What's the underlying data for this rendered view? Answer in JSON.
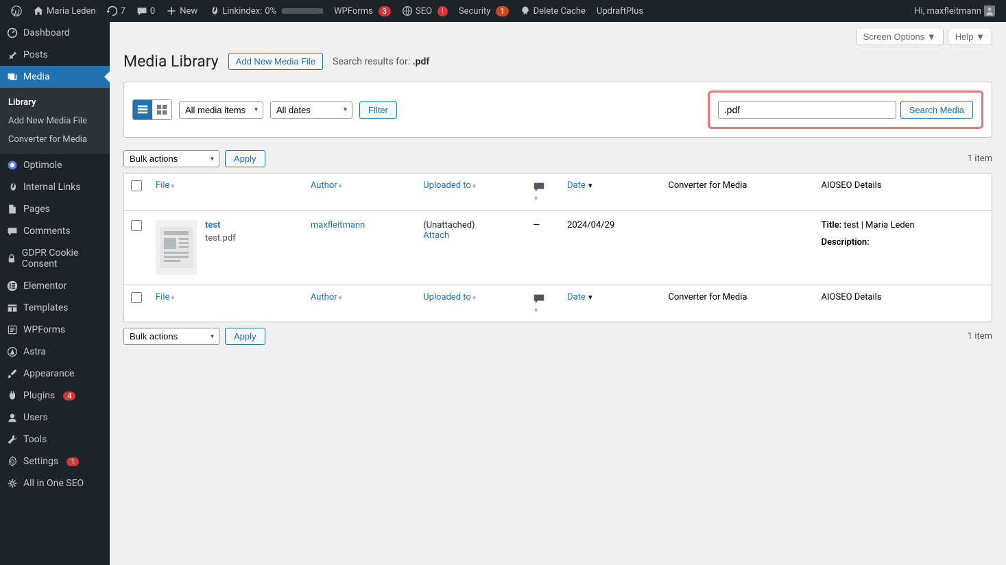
{
  "adminbar": {
    "site_name": "Maria Leden",
    "updates": "7",
    "comments": "0",
    "new_label": "New",
    "linkindex_label": "Linkindex:",
    "linkindex_pct": "0%",
    "wpforms_label": "WPForms",
    "wpforms_count": "3",
    "seo_label": "SEO",
    "seo_badge": "!",
    "security_label": "Security",
    "security_count": "1",
    "delete_cache": "Delete Cache",
    "updraft": "UpdraftPlus",
    "greeting": "Hi, maxfleitmann"
  },
  "screen": {
    "options": "Screen Options",
    "help": "Help"
  },
  "sidebar": {
    "dashboard": "Dashboard",
    "posts": "Posts",
    "media": "Media",
    "library": "Library",
    "add_new": "Add New Media File",
    "converter": "Converter for Media",
    "optimole": "Optimole",
    "internal_links": "Internal Links",
    "pages": "Pages",
    "comments": "Comments",
    "gdpr": "GDPR Cookie Consent",
    "elementor": "Elementor",
    "templates": "Templates",
    "wpforms": "WPForms",
    "astra": "Astra",
    "appearance": "Appearance",
    "plugins": "Plugins",
    "plugins_count": "4",
    "users": "Users",
    "tools": "Tools",
    "settings": "Settings",
    "settings_count": "1",
    "aioseo": "All in One SEO"
  },
  "page": {
    "title": "Media Library",
    "add_new": "Add New Media File",
    "search_results_label": "Search results for:",
    "search_term": ".pdf"
  },
  "filters": {
    "all_media": "All media items",
    "all_dates": "All dates",
    "filter_btn": "Filter",
    "search_value": ".pdf",
    "search_btn": "Search Media"
  },
  "bulk": {
    "actions": "Bulk actions",
    "apply": "Apply",
    "count": "1 item"
  },
  "columns": {
    "file": "File",
    "author": "Author",
    "uploaded_to": "Uploaded to",
    "date": "Date",
    "converter": "Converter for Media",
    "aioseo": "AIOSEO Details"
  },
  "row": {
    "title": "test",
    "filename": "test.pdf",
    "author": "maxfleitmann",
    "unattached": "(Unattached)",
    "attach": "Attach",
    "comments": "—",
    "date": "2024/04/29",
    "aioseo_title_label": "Title:",
    "aioseo_title": "test | Maria Leden",
    "aioseo_desc_label": "Description:"
  }
}
